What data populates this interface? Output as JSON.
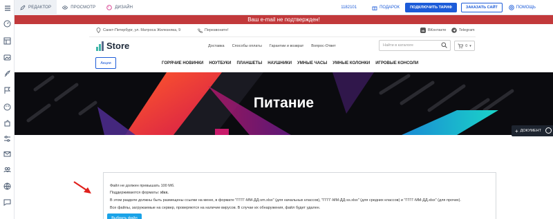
{
  "editor": {
    "tabs": [
      {
        "label": "Редактор"
      },
      {
        "label": "Просмотр"
      },
      {
        "label": "Дизайн"
      }
    ],
    "site_id": "1182101",
    "gift_label": "Подарок",
    "connect_label": "Подключить тариф",
    "order_label": "Заказать сайт",
    "help_label": "Помощь"
  },
  "banner": {
    "text": "Ваш e-mail не подтвержден!"
  },
  "site": {
    "address": "Санкт-Петербург, ул. Матроса Железняка, 9",
    "callback": "Перезвоните!",
    "vk": "ВКонтакте",
    "telegram": "Telegram",
    "logo": "Store",
    "nav1": [
      "Доставка",
      "Способы оплаты",
      "Гарантии и возврат",
      "Вопрос-Ответ"
    ],
    "search_placeholder": "Найти в каталоге",
    "cart_count": "0",
    "promo_label": "Акции",
    "nav2": [
      "ГОРЯЧИЕ НОВИНКИ",
      "НОУТБУКИ",
      "ПЛАНШЕТЫ",
      "НАУШНИКИ",
      "УМНЫЕ ЧАСЫ",
      "УМНЫЕ КОЛОНКИ",
      "ИГРОВЫЕ КОНСОЛИ"
    ],
    "hero_title": "Питание"
  },
  "document_button": "Документ",
  "upload": {
    "line1": "Файл не должен превышать 100 Мб.",
    "line2_prefix": "Поддерживаются форматы: ",
    "line2_format": "xlsx.",
    "line3": "В этом разделе должны быть размещены ссылки на меню, в формате \"ГГГГ-ММ-ДД-sm.xlsx\" (для начальных классов), \"ГГГГ-ММ-ДД-ss.xlsx\" (для средних классов) и \"ГГГГ-ММ-ДД.xlsx\" (для прочих).",
    "line4": "Все файлы, загружаемые на сервер, проверяются на наличие вирусов. В случае их обнаружения, файл будет удален.",
    "button": "Выбрать файл"
  },
  "colors": {
    "accent": "#1c5bd8",
    "banner": "#c2393b",
    "upload_button": "#1aa3e8",
    "arrow": "#e0201c"
  }
}
